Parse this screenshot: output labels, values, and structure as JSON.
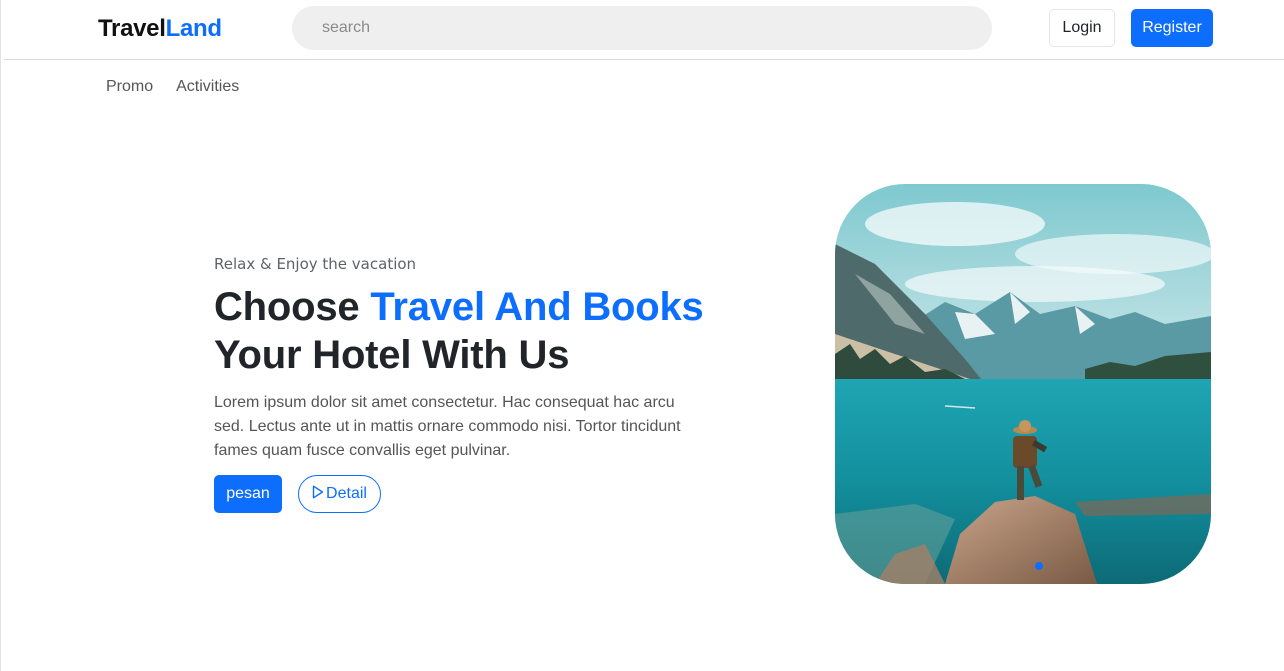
{
  "header": {
    "brand_part1": "Travel",
    "brand_part2": "Land",
    "search_placeholder": "search",
    "login_label": "Login",
    "register_label": "Register"
  },
  "subnav": {
    "items": [
      {
        "label": "Promo"
      },
      {
        "label": "Activities"
      }
    ]
  },
  "hero": {
    "tagline": "Relax & Enjoy the vacation",
    "headline_part1": "Choose ",
    "headline_accent": "Travel And Books",
    "headline_part2": "Your Hotel With Us",
    "description": "Lorem ipsum dolor sit amet consectetur. Hac consequat hac arcu sed. Lectus ante ut in mattis ornare commodo nisi. Tortor tincidunt fames quam fusce convallis eget pulvinar.",
    "primary_button": "pesan",
    "secondary_button": "Detail",
    "secondary_icon": "play-icon"
  },
  "carousel": {
    "image": "mountain-lake-hiker-photo",
    "indicator_active": 1
  },
  "colors": {
    "accent": "#0d6efd",
    "text": "#212529",
    "muted": "#555555"
  }
}
